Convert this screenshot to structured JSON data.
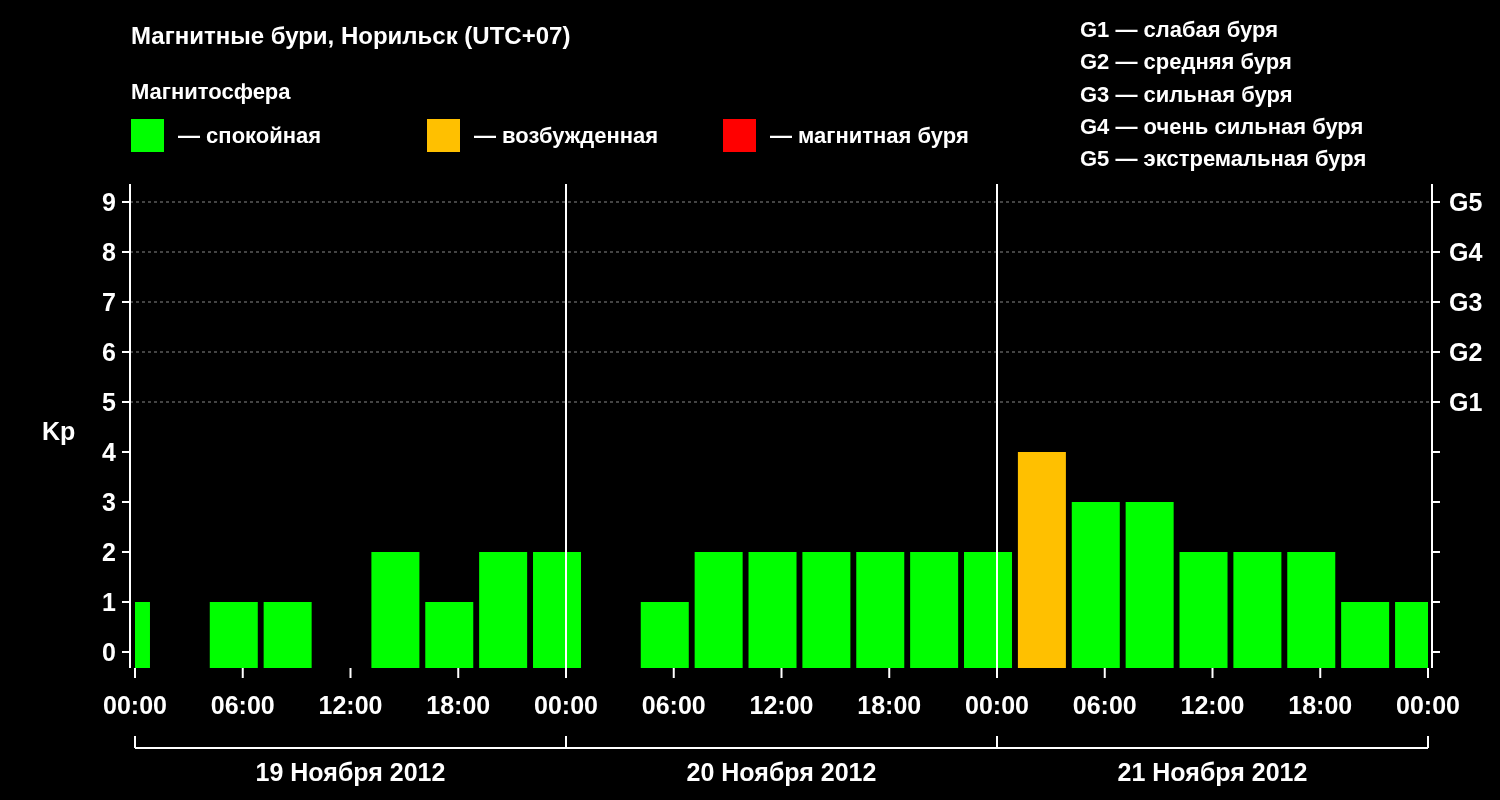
{
  "header": {
    "title": "Магнитные бури, Норильск (UTC+07)",
    "legend_title": "Магнитосфера",
    "legend": [
      {
        "label": "— спокойная",
        "color": "#00ff00"
      },
      {
        "label": "— возбужденная",
        "color": "#ffc000"
      },
      {
        "label": "— магнитная буря",
        "color": "#ff0000"
      }
    ],
    "storm_levels": [
      "G1 — слабая буря",
      "G2 — средняя буря",
      "G3 — сильная буря",
      "G4 — очень сильная буря",
      "G5 — экстремальная буря"
    ]
  },
  "chart": {
    "chart_data": {
      "type": "bar",
      "ylabel": "Kp",
      "x": [
        "2012-11-19T00:25",
        "2012-11-19T05:30",
        "2012-11-19T08:30",
        "2012-11-19T14:30",
        "2012-11-19T17:30",
        "2012-11-19T20:30",
        "2012-11-19T23:30",
        "2012-11-20T05:30",
        "2012-11-20T08:30",
        "2012-11-20T11:30",
        "2012-11-20T14:30",
        "2012-11-20T17:30",
        "2012-11-20T20:30",
        "2012-11-20T23:30",
        "2012-11-21T02:30",
        "2012-11-21T05:30",
        "2012-11-21T08:30",
        "2012-11-21T11:30",
        "2012-11-21T14:30",
        "2012-11-21T17:30",
        "2012-11-21T20:30",
        "2012-11-21T23:05"
      ],
      "series": [
        {
          "values": [
            1,
            1,
            1,
            2,
            1,
            2,
            2,
            1,
            2,
            2,
            2,
            2,
            2,
            2,
            4,
            3,
            3,
            2,
            2,
            2,
            1,
            1
          ]
        }
      ],
      "xlim": [
        "2012-11-19T00:00",
        "2012-11-22T00:00"
      ],
      "ylim": [
        0,
        9
      ],
      "grid": true,
      "xticks": [
        {
          "value": "2012-11-19T00:00",
          "label": "00:00"
        },
        {
          "value": "2012-11-19T06:00",
          "label": "06:00"
        },
        {
          "value": "2012-11-19T12:00",
          "label": "12:00"
        },
        {
          "value": "2012-11-19T18:00",
          "label": "18:00"
        },
        {
          "value": "2012-11-20T00:00",
          "label": "00:00"
        },
        {
          "value": "2012-11-20T06:00",
          "label": "06:00"
        },
        {
          "value": "2012-11-20T12:00",
          "label": "12:00"
        },
        {
          "value": "2012-11-20T18:00",
          "label": "18:00"
        },
        {
          "value": "2012-11-21T00:00",
          "label": "00:00"
        },
        {
          "value": "2012-11-21T06:00",
          "label": "06:00"
        },
        {
          "value": "2012-11-21T12:00",
          "label": "12:00"
        },
        {
          "value": "2012-11-21T18:00",
          "label": "18:00"
        },
        {
          "value": "2012-11-22T00:00",
          "label": "00:00"
        }
      ],
      "yticks": [
        0,
        1,
        2,
        3,
        4,
        5,
        6,
        7,
        8,
        9
      ]
    },
    "right_tick_labels": [
      "G5",
      "G4",
      "G3",
      "G2",
      "G1"
    ],
    "days": [
      "19 Ноября 2012",
      "20 Ноября 2012",
      "21 Ноября 2012"
    ]
  }
}
